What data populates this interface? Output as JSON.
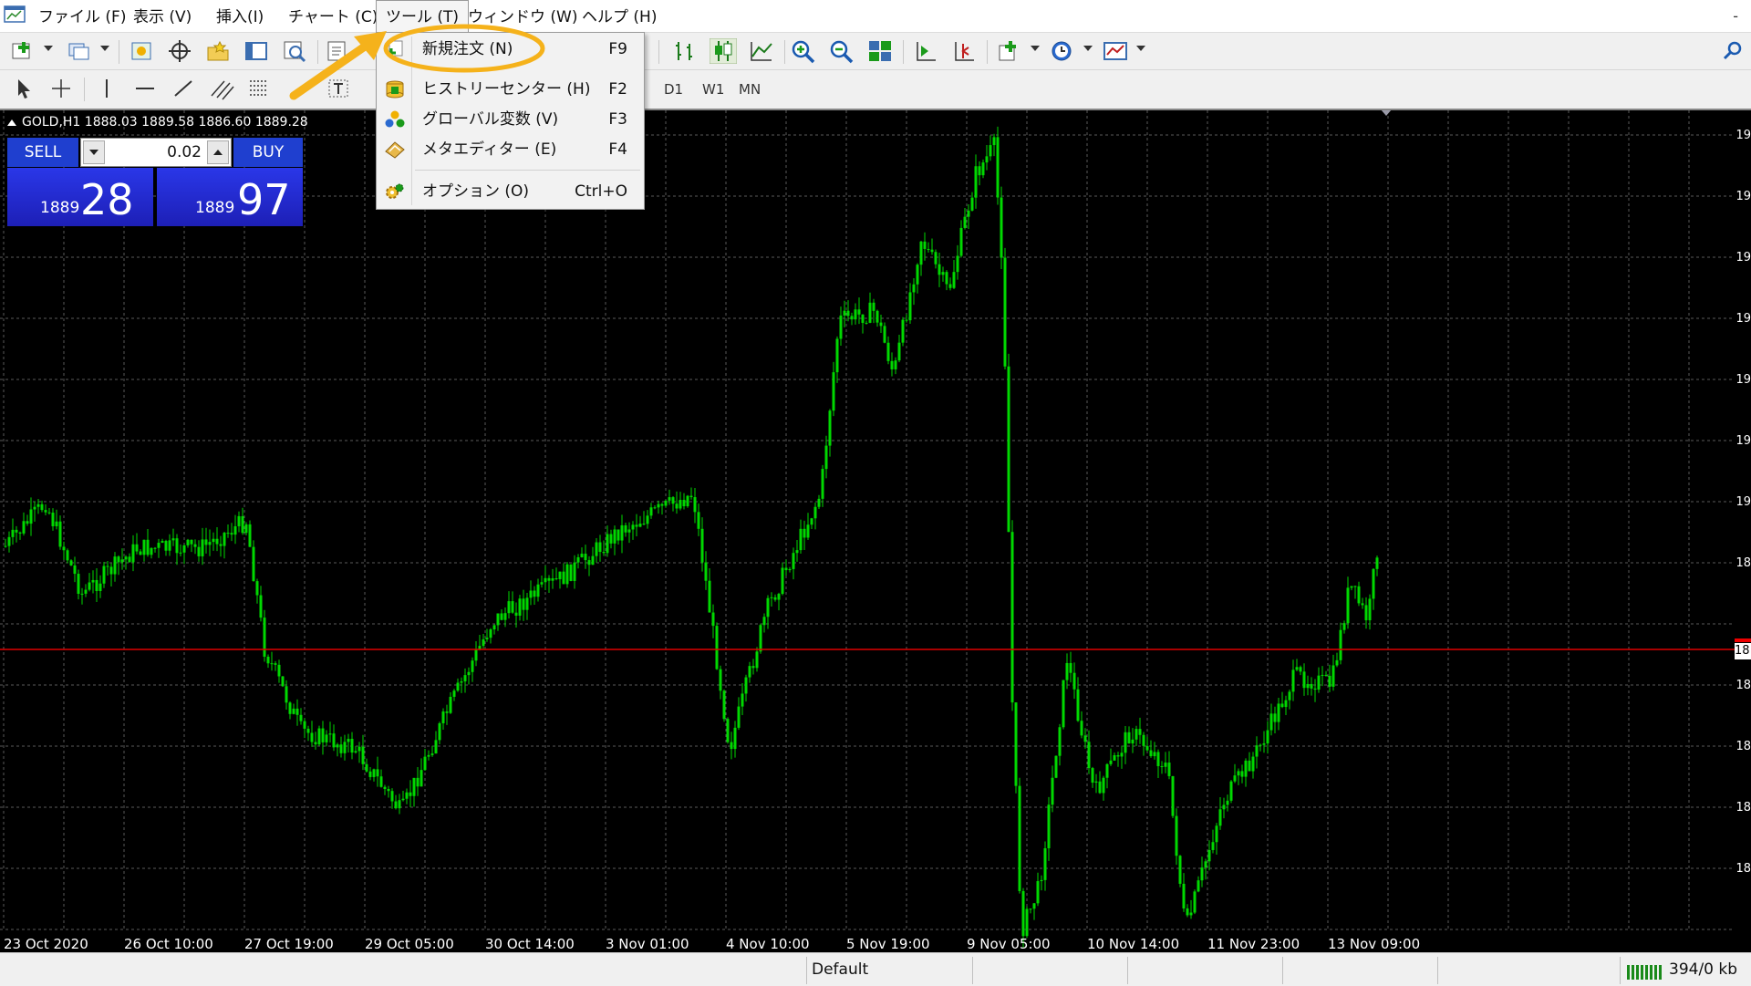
{
  "menubar": {
    "items": [
      "ファイル (F)",
      "表示 (V)",
      "挿入(I)",
      "チャート (C)",
      "ツール (T)",
      "ウィンドウ (W)",
      "ヘルプ (H)"
    ],
    "minimize": "-"
  },
  "dropdown": {
    "items": [
      {
        "label": "新規注文 (N)",
        "shortcut": "F9",
        "icon": "new-order-icon"
      },
      {
        "label": "ヒストリーセンター (H)",
        "shortcut": "F2",
        "icon": "history-center-icon"
      },
      {
        "label": "グローバル変数 (V)",
        "shortcut": "F3",
        "icon": "global-variables-icon"
      },
      {
        "label": "メタエディター (E)",
        "shortcut": "F4",
        "icon": "metaeditor-icon"
      },
      {
        "label": "オプション (O)",
        "shortcut": "Ctrl+O",
        "icon": "options-icon"
      }
    ],
    "highlight_color": "#f5b21b"
  },
  "timeframes": [
    "D1",
    "W1",
    "MN"
  ],
  "chart": {
    "info": "GOLD,H1  1888.03 1889.58 1886.60 1889.28",
    "candle_color": "#00d800",
    "bid_line_color": "#e00000",
    "grid_color": "#5a5a5a",
    "x_labels": [
      "23 Oct 2020",
      "26 Oct 10:00",
      "27 Oct 19:00",
      "29 Oct 05:00",
      "30 Oct 14:00",
      "3 Nov 01:00",
      "4 Nov 10:00",
      "5 Nov 19:00",
      "9 Nov 05:00",
      "10 Nov 14:00",
      "11 Nov 23:00",
      "13 Nov 09:00"
    ],
    "right_labels": [
      "19",
      "19",
      "19",
      "19",
      "19",
      "19",
      "19",
      "18",
      "18",
      "18",
      "18",
      "18",
      "18"
    ],
    "bid_label": "18"
  },
  "trade_panel": {
    "sell_label": "SELL",
    "buy_label": "BUY",
    "lot": "0.02",
    "sell_price_small": "1889",
    "sell_price_big": "28",
    "buy_price_small": "1889",
    "buy_price_big": "97"
  },
  "statusbar": {
    "profile": "Default",
    "traffic": "394/0 kb"
  }
}
